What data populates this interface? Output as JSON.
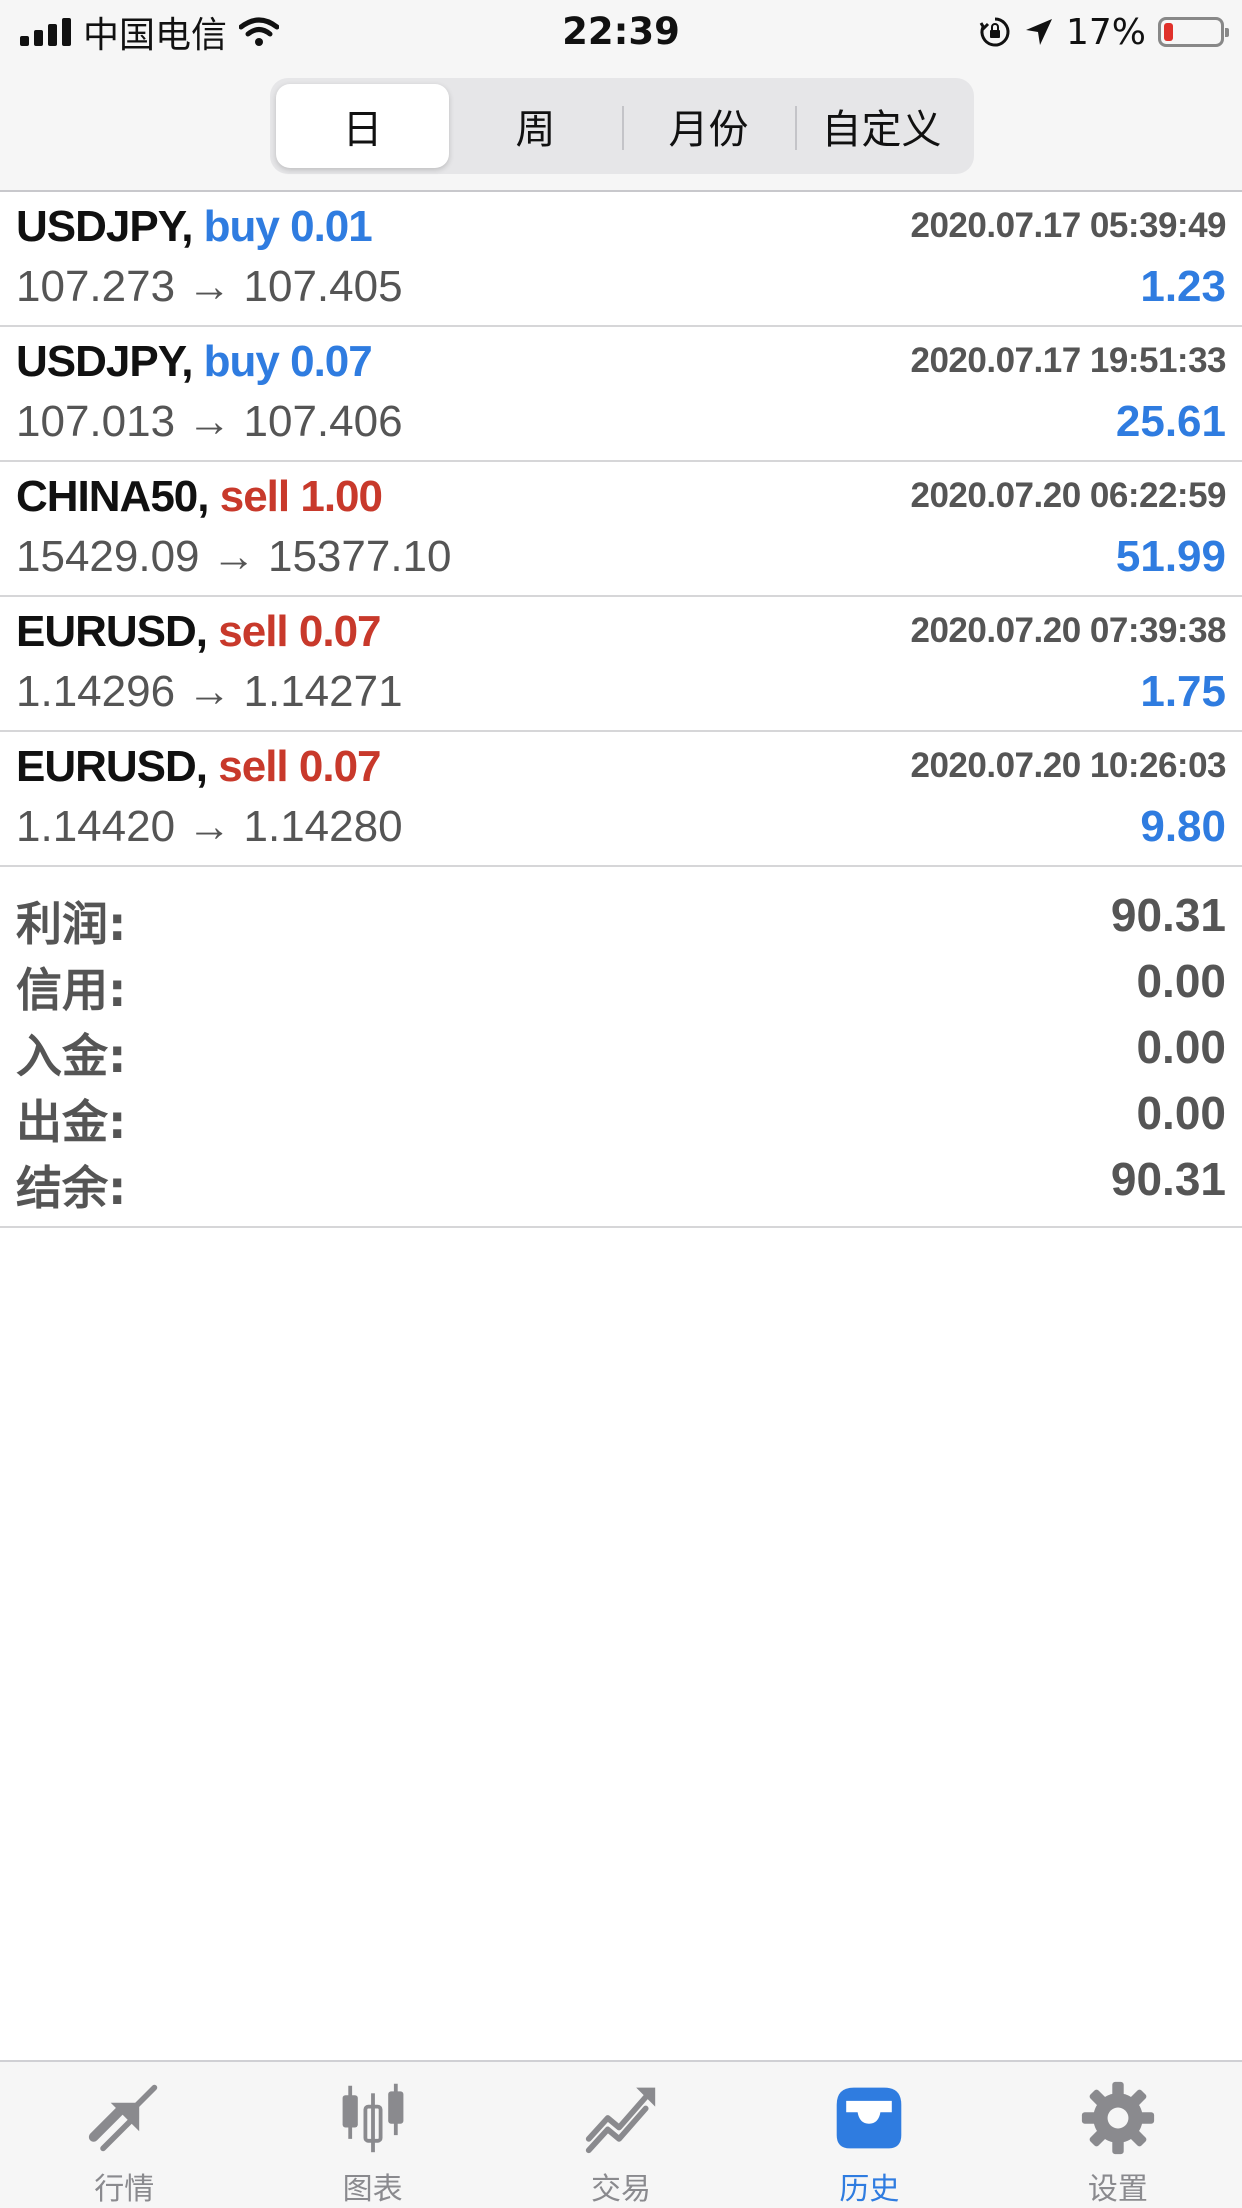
{
  "status_bar": {
    "carrier": "中国电信",
    "time": "22:39",
    "battery": "17%",
    "battery_level": 0.17
  },
  "period_tabs": [
    {
      "label": "日",
      "active": true
    },
    {
      "label": "周",
      "active": false
    },
    {
      "label": "月份",
      "active": false
    },
    {
      "label": "自定义",
      "active": false
    }
  ],
  "trades": [
    {
      "symbol": "USDJPY,",
      "side": "buy 0.01",
      "time": "2020.07.17 05:39:49",
      "prices": "107.273 → 107.405",
      "profit": "1.23"
    },
    {
      "symbol": "USDJPY,",
      "side": "buy 0.07",
      "time": "2020.07.17 19:51:33",
      "prices": "107.013 → 107.406",
      "profit": "25.61"
    },
    {
      "symbol": "CHINA50,",
      "side": "sell 1.00",
      "time": "2020.07.20 06:22:59",
      "prices": "15429.09 → 15377.10",
      "profit": "51.99"
    },
    {
      "symbol": "EURUSD,",
      "side": "sell 0.07",
      "time": "2020.07.20 07:39:38",
      "prices": "1.14296 → 1.14271",
      "profit": "1.75"
    },
    {
      "symbol": "EURUSD,",
      "side": "sell 0.07",
      "time": "2020.07.20 10:26:03",
      "prices": "1.14420 → 1.14280",
      "profit": "9.80"
    }
  ],
  "summary": [
    {
      "label": "利润:",
      "value": "90.31"
    },
    {
      "label": "信用:",
      "value": "0.00"
    },
    {
      "label": "入金:",
      "value": "0.00"
    },
    {
      "label": "出金:",
      "value": "0.00"
    },
    {
      "label": "结余:",
      "value": "90.31"
    }
  ],
  "tab_bar": [
    {
      "label": "行情",
      "icon": "quotes-arrows-icon",
      "active": false
    },
    {
      "label": "图表",
      "icon": "candlestick-chart-icon",
      "active": false
    },
    {
      "label": "交易",
      "icon": "trade-trend-icon",
      "active": false
    },
    {
      "label": "历史",
      "icon": "history-inbox-icon",
      "active": true
    },
    {
      "label": "设置",
      "icon": "gear-icon",
      "active": false
    }
  ],
  "colors": {
    "buy": "#2f7ce0",
    "sell": "#c8392b",
    "active_tab": "#2f7ce0",
    "inactive_tab": "#8a8a8e"
  }
}
